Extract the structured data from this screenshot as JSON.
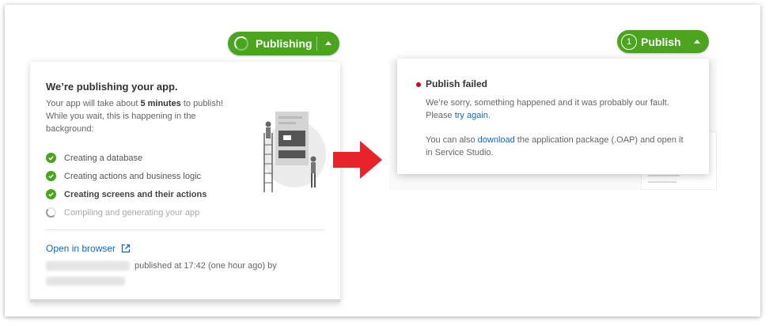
{
  "colors": {
    "accent_green": "#4aa41e",
    "link_blue": "#1068c4",
    "error_red": "#d0021b",
    "arrow_red": "#e8232a"
  },
  "left": {
    "button": {
      "label": "Publishing",
      "icon": "spinner-icon",
      "caret": "caret-up-icon"
    },
    "panel": {
      "title": "We’re publishing your app.",
      "desc_prefix": "Your app will take about ",
      "desc_bold": "5 minutes",
      "desc_suffix": " to publish! While you wait, this is happening in the background:",
      "steps": [
        {
          "label": "Creating a database",
          "status": "done"
        },
        {
          "label": "Creating actions and business logic",
          "status": "done"
        },
        {
          "label": "Creating screens and their actions",
          "status": "done"
        },
        {
          "label": "Compiling and generating your app",
          "status": "in-progress"
        }
      ],
      "open_in_browser": "Open in browser",
      "published_text": "published at 17:42 (one hour ago) by"
    }
  },
  "right": {
    "button": {
      "number": "1",
      "label": "Publish",
      "caret": "caret-up-icon"
    },
    "panel": {
      "title": "Publish failed",
      "msg_line": "We’re sorry, something happened and it was probably our fault.",
      "msg_please": "Please ",
      "try_again": "try again",
      "msg_period": ".",
      "also_prefix": "You can also ",
      "download": "download",
      "also_suffix": " the application package (.OAP) and open it in Service Studio."
    }
  }
}
